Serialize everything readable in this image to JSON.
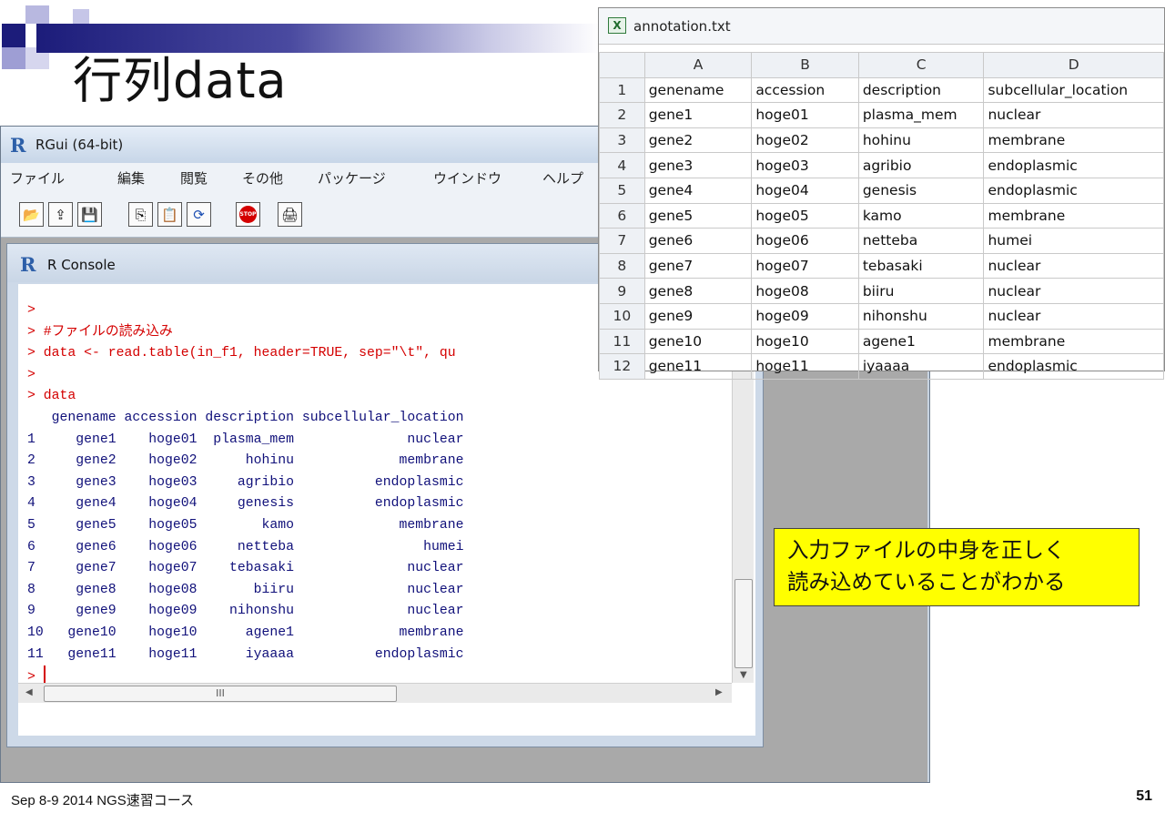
{
  "slide": {
    "title": "行列data",
    "footer": "Sep 8-9 2014 NGS速習コース",
    "page_number": "51",
    "callout_lines": [
      "入力ファイルの中身を正しく",
      "読み込めていることがわかる"
    ]
  },
  "rgui": {
    "title": "RGui (64-bit)",
    "menu": [
      "ファイル",
      "編集",
      "閲覧",
      "その他",
      "パッケージ",
      "ウインドウ",
      "ヘルプ"
    ],
    "console_title": "R Console",
    "hscroll_label": "III",
    "console_lines": [
      {
        "text": ">",
        "color": "red"
      },
      {
        "text": "> #ファイルの読み込み",
        "color": "red"
      },
      {
        "text": "> data <- read.table(in_f1, header=TRUE, sep=\"\\t\", qu",
        "color": "red"
      },
      {
        "text": ">",
        "color": "red"
      },
      {
        "text": "> data",
        "color": "red"
      },
      {
        "text": "   genename accession description subcellular_location",
        "color": "blue"
      },
      {
        "text": "1     gene1    hoge01  plasma_mem              nuclear",
        "color": "blue"
      },
      {
        "text": "2     gene2    hoge02      hohinu             membrane",
        "color": "blue"
      },
      {
        "text": "3     gene3    hoge03     agribio          endoplasmic",
        "color": "blue"
      },
      {
        "text": "4     gene4    hoge04     genesis          endoplasmic",
        "color": "blue"
      },
      {
        "text": "5     gene5    hoge05        kamo             membrane",
        "color": "blue"
      },
      {
        "text": "6     gene6    hoge06     netteba                humei",
        "color": "blue"
      },
      {
        "text": "7     gene7    hoge07    tebasaki              nuclear",
        "color": "blue"
      },
      {
        "text": "8     gene8    hoge08       biiru              nuclear",
        "color": "blue"
      },
      {
        "text": "9     gene9    hoge09    nihonshu              nuclear",
        "color": "blue"
      },
      {
        "text": "10   gene10    hoge10      agene1             membrane",
        "color": "blue"
      },
      {
        "text": "11   gene11    hoge11      iyaaaa          endoplasmic",
        "color": "blue"
      }
    ],
    "prompt": "> "
  },
  "sheet": {
    "title": "annotation.txt",
    "columns": [
      "A",
      "B",
      "C",
      "D"
    ],
    "rows": [
      [
        "1",
        "genename",
        "accession",
        "description",
        "subcellular_location"
      ],
      [
        "2",
        "gene1",
        "hoge01",
        "plasma_mem",
        "nuclear"
      ],
      [
        "3",
        "gene2",
        "hoge02",
        "hohinu",
        "membrane"
      ],
      [
        "4",
        "gene3",
        "hoge03",
        "agribio",
        "endoplasmic"
      ],
      [
        "5",
        "gene4",
        "hoge04",
        "genesis",
        "endoplasmic"
      ],
      [
        "6",
        "gene5",
        "hoge05",
        "kamo",
        "membrane"
      ],
      [
        "7",
        "gene6",
        "hoge06",
        "netteba",
        "humei"
      ],
      [
        "8",
        "gene7",
        "hoge07",
        "tebasaki",
        "nuclear"
      ],
      [
        "9",
        "gene8",
        "hoge08",
        "biiru",
        "nuclear"
      ],
      [
        "10",
        "gene9",
        "hoge09",
        "nihonshu",
        "nuclear"
      ],
      [
        "11",
        "gene10",
        "hoge10",
        "agene1",
        "membrane"
      ],
      [
        "12",
        "gene11",
        "hoge11",
        "iyaaaa",
        "endoplasmic"
      ]
    ]
  },
  "colors": {
    "prompt_red": "#d40000",
    "output_blue": "#10107a",
    "callout_yellow": "#ffff00",
    "title_bar_navy": "#1c1c7a"
  },
  "icons": [
    "r-logo-icon",
    "open-folder-icon",
    "load-workspace-icon",
    "save-icon",
    "copy-icon",
    "paste-icon",
    "refresh-icon",
    "stop-icon",
    "print-icon",
    "excel-file-icon"
  ]
}
